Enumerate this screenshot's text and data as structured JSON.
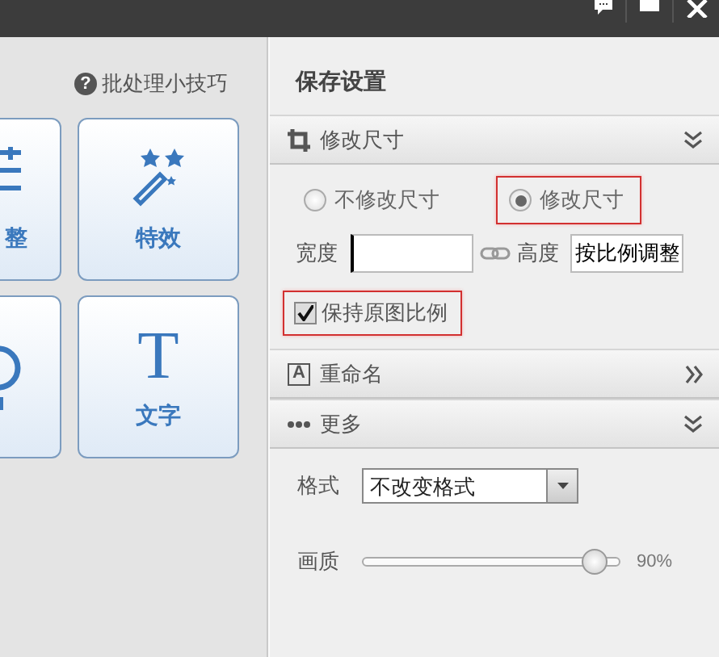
{
  "tips_link": "批处理小技巧",
  "tools": [
    {
      "kind": "adjust",
      "label": "整"
    },
    {
      "kind": "effects",
      "label": "特效"
    },
    {
      "kind": "frame"
    },
    {
      "kind": "text",
      "label": "文字",
      "icon_text": "T"
    }
  ],
  "tips_icon": "?",
  "panel": {
    "title": "保存设置",
    "sections": [
      {
        "kind": "crop",
        "label": "修改尺寸",
        "expanded": true
      },
      {
        "kind": "rename",
        "label": "重命名",
        "expanded": false,
        "icon_text": "A"
      },
      {
        "kind": "more",
        "label": "更多",
        "expanded": true
      }
    ],
    "resize_options": [
      {
        "label": "不修改尺寸",
        "selected": false,
        "highlighted": false
      },
      {
        "label": "修改尺寸",
        "selected": true,
        "highlighted": true
      }
    ],
    "width": {
      "label": "宽度"
    },
    "height": {
      "label": "高度",
      "value": "按比例调整"
    },
    "keep_ratio": {
      "label": "保持原图比例",
      "checked": true,
      "highlighted": true
    },
    "format": {
      "label": "格式",
      "value": "不改变格式"
    },
    "quality": {
      "label": "画质",
      "level": 0.9,
      "reading": "90%"
    }
  }
}
